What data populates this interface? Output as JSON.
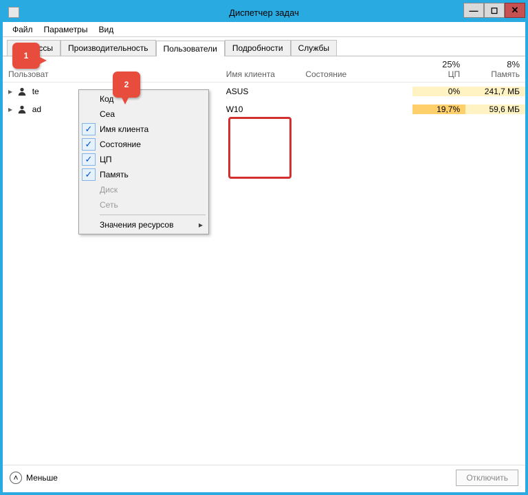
{
  "window": {
    "title": "Диспетчер задач"
  },
  "menubar": {
    "file": "Файл",
    "options": "Параметры",
    "view": "Вид"
  },
  "tabs": {
    "processes": "Процессы",
    "performance": "Производительность",
    "users": "Пользователи",
    "details": "Подробности",
    "services": "Службы"
  },
  "columns": {
    "user": "Пользоват",
    "client": "Имя клиента",
    "state": "Состояние",
    "cpu_pct": "25%",
    "cpu_lbl": "ЦП",
    "mem_pct": "8%",
    "mem_lbl": "Память"
  },
  "rows": [
    {
      "user": "te",
      "client": "ASUS",
      "state": "",
      "cpu": "0%",
      "mem": "241,7 МБ"
    },
    {
      "user": "ad",
      "client": "W10",
      "state": "",
      "cpu": "19,7%",
      "mem": "59,6 МБ"
    }
  ],
  "context": {
    "code": "Код",
    "session": "Сеа",
    "client": "Имя клиента",
    "state": "Состояние",
    "cpu": "ЦП",
    "memory": "Память",
    "disk": "Диск",
    "network": "Сеть",
    "resource_values": "Значения ресурсов"
  },
  "callouts": {
    "one": "1",
    "two": "2"
  },
  "footer": {
    "fewer": "Меньше",
    "disconnect": "Отключить"
  }
}
